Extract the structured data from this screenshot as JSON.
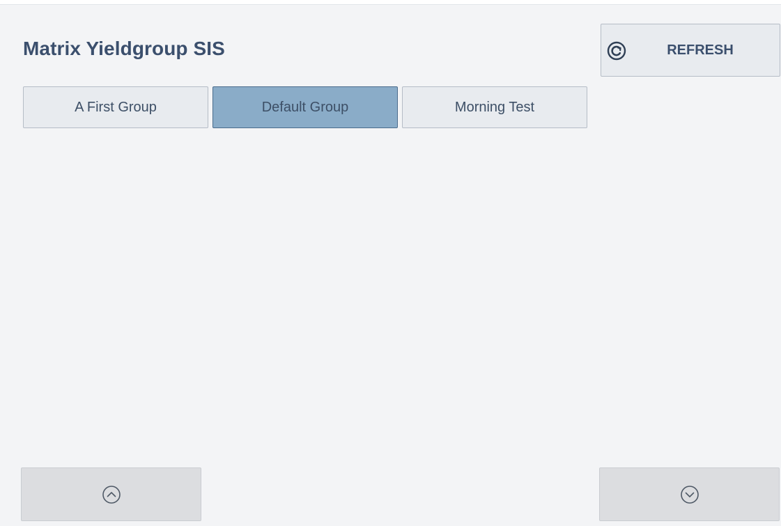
{
  "header": {
    "title": "Matrix Yieldgroup SIS",
    "refresh_label": "REFRESH",
    "refresh_icon": "refresh-circle-icon"
  },
  "groups": {
    "items": [
      {
        "label": "A First Group",
        "selected": false
      },
      {
        "label": "Default Group",
        "selected": true
      },
      {
        "label": "Morning Test",
        "selected": false
      }
    ]
  },
  "navigation": {
    "scroll_up_icon": "chevron-up-circle-icon",
    "scroll_down_icon": "chevron-down-circle-icon"
  },
  "colors": {
    "background": "#f3f4f6",
    "button_background": "#e8ebef",
    "selected_tab": "#8aacc8",
    "title_text": "#3b4f6d",
    "disabled_button": "#dcdde0"
  }
}
